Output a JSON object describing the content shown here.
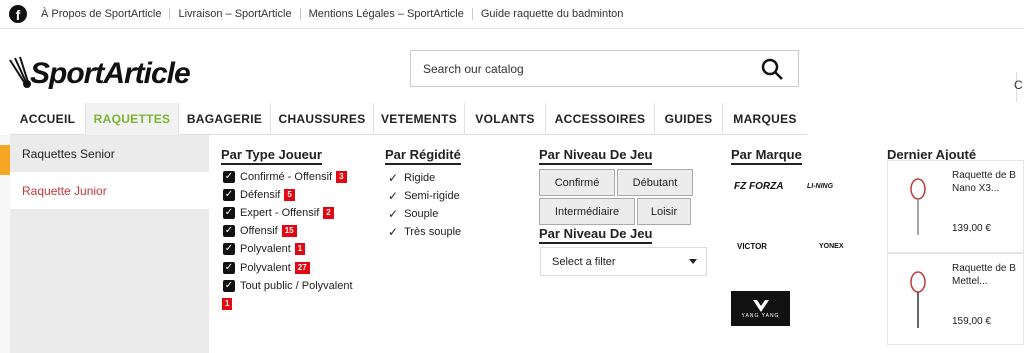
{
  "topbar": {
    "icon": "facebook-icon",
    "links": [
      "À Propos de SportArticle",
      "Livraison – SportArticle",
      "Mentions Légales – SportArticle",
      "Guide raquette du badminton"
    ]
  },
  "logo": {
    "text": "SportArticle"
  },
  "search": {
    "placeholder": "Search our catalog"
  },
  "cart": {
    "label": "C"
  },
  "nav": {
    "items": [
      "ACCUEIL",
      "RAQUETTES",
      "BAGAGERIE",
      "CHAUSSURES",
      "VETEMENTS",
      "VOLANTS",
      "ACCESSOIRES",
      "GUIDES",
      "MARQUES"
    ],
    "active": "RAQUETTES",
    "accent_color": "#7ab534"
  },
  "sidebar": {
    "items": [
      "Raquettes Senior",
      "Raquette Junior"
    ]
  },
  "filters": {
    "type_joueur": {
      "title": "Par Type Joueur",
      "options": [
        {
          "label": "Confirmé - Offensif",
          "count": "3"
        },
        {
          "label": "Défensif",
          "count": "5"
        },
        {
          "label": "Expert - Offensif",
          "count": "2"
        },
        {
          "label": "Offensif",
          "count": "15"
        },
        {
          "label": "Polyvalent",
          "count": "1"
        },
        {
          "label": "Polyvalent",
          "count": "27"
        },
        {
          "label": "Tout public / Polyvalent",
          "count": "1"
        }
      ]
    },
    "rigidite": {
      "title": "Par Régidité",
      "options": [
        "Rigide",
        "Semi-rigide",
        "Souple",
        "Très souple"
      ]
    },
    "niveau": {
      "title": "Par Niveau De Jeu",
      "buttons": [
        "Confirmé",
        "Débutant",
        "Intermédiaire",
        "Loisir"
      ]
    },
    "niveau_select": {
      "title": "Par Niveau De Jeu",
      "value": "Select a filter"
    },
    "marque": {
      "title": "Par Marque",
      "brands": [
        "FZ FORZA",
        "LI-NING",
        "VICTOR",
        "YONEX",
        "YANG YANG"
      ]
    }
  },
  "latest": {
    "title": "Dernier Ajouté",
    "products": [
      {
        "name1": "Raquette de B",
        "name2": "Nano X3...",
        "price": "139,00 €"
      },
      {
        "name1": "Raquette de B",
        "name2": "Mettel...",
        "price": "159,00 €"
      }
    ]
  }
}
